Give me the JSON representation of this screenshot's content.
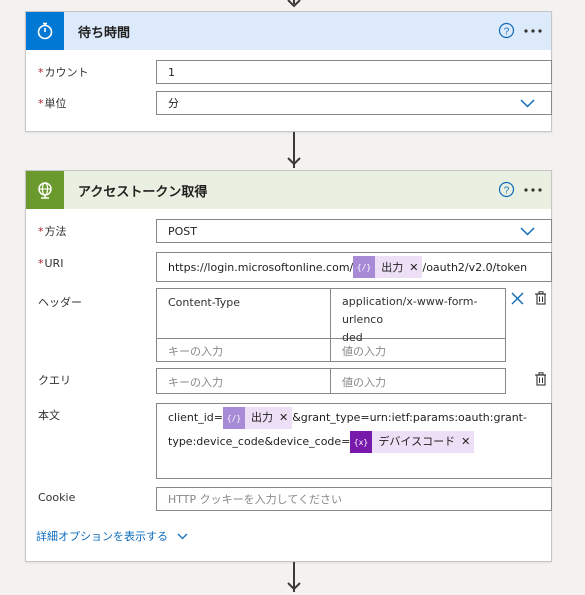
{
  "wait_card": {
    "title": "待ち時間",
    "accent": "#0078d4",
    "header_bg": "#ddeafc",
    "fields": {
      "count": {
        "label": "カウント",
        "value": "1"
      },
      "unit": {
        "label": "単位",
        "value": "分"
      }
    }
  },
  "token_card": {
    "title": "アクセストークン取得",
    "accent": "#6a9a2e",
    "header_bg": "#eaf0e1",
    "method": {
      "label": "方法",
      "value": "POST"
    },
    "uri": {
      "label": "URI",
      "prefix": "https://login.microsoftonline.com/",
      "token_label": "出力",
      "suffix": "/oauth2/v2.0/token"
    },
    "headers": {
      "label": "ヘッダー",
      "key": "Content-Type",
      "value_line1": "application/x-www-form-urlenco",
      "value_line2": "ded",
      "key_placeholder": "キーの入力",
      "value_placeholder": "値の入力"
    },
    "query": {
      "label": "クエリ",
      "key_placeholder": "キーの入力",
      "value_placeholder": "値の入力"
    },
    "body": {
      "label": "本文",
      "part1": "client_id=",
      "token1_label": "出力",
      "part2": "&grant_type=urn:ietf:params:oauth:grant-",
      "part3": "type:device_code&device_code=",
      "token2_label": "デバイスコード"
    },
    "cookie": {
      "label": "Cookie",
      "placeholder": "HTTP クッキーを入力してください"
    },
    "advanced_label": "詳細オプションを表示する"
  },
  "icons": {
    "wait": "stopwatch-icon",
    "http": "globe-icon",
    "help": "help-circle-icon",
    "more": "more-dots-icon",
    "expression": "expression-icon",
    "delete": "delete-row-icon"
  }
}
